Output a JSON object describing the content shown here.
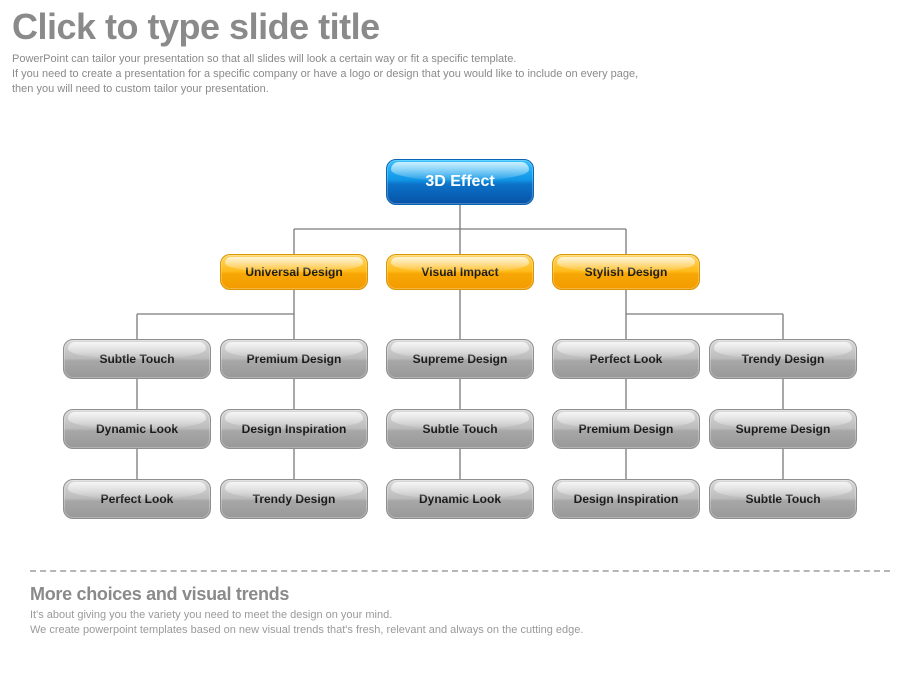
{
  "title": "Click to type slide title",
  "subtitle_line1": "PowerPoint can tailor your presentation so that all slides will look a certain way or fit a specific template.",
  "subtitle_line2": "If you need to create a presentation for a specific company or have a logo or design that you would like to include on every page,",
  "subtitle_line3": "then you will need to custom tailor your presentation.",
  "chart_data": {
    "type": "org-chart",
    "root": {
      "label": "3D Effect",
      "color": "#1195e6"
    },
    "branches": [
      {
        "label": "Universal Design",
        "color": "#ffbb1a",
        "children": [
          "Subtle Touch",
          "Premium Design",
          "Dynamic Look",
          "Design Inspiration",
          "Perfect Look",
          "Trendy Design"
        ]
      },
      {
        "label": "Visual Impact",
        "color": "#ffbb1a",
        "children": [
          "Supreme Design",
          "Subtle Touch",
          "Dynamic Look"
        ]
      },
      {
        "label": "Stylish Design",
        "color": "#ffbb1a",
        "children": [
          "Perfect Look",
          "Trendy Design",
          "Premium Design",
          "Supreme Design",
          "Design Inspiration",
          "Subtle Touch"
        ]
      }
    ]
  },
  "root": "3D Effect",
  "b0": "Universal Design",
  "b1": "Visual Impact",
  "b2": "Stylish Design",
  "c0": "Subtle Touch",
  "c1": "Premium Design",
  "c2": "Supreme Design",
  "c3": "Perfect Look",
  "c4": "Trendy Design",
  "c5": "Dynamic Look",
  "c6": "Design Inspiration",
  "c7": "Subtle Touch",
  "c8": "Premium Design",
  "c9": "Supreme Design",
  "c10": "Perfect Look",
  "c11": "Trendy Design",
  "c12": "Dynamic Look",
  "c13": "Design Inspiration",
  "c14": "Subtle Touch",
  "footer_title": "More choices and visual trends",
  "footer_line1": "It's about giving you the variety you need to meet the design on your mind.",
  "footer_line2": "We create powerpoint templates based on new visual trends that's fresh, relevant and always on the cutting edge."
}
